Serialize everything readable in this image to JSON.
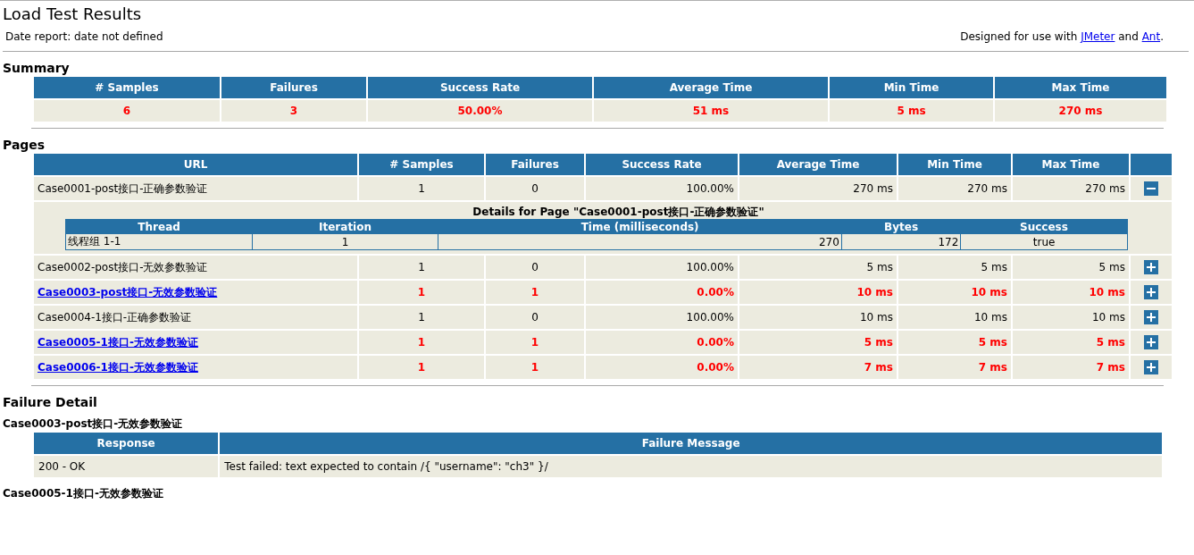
{
  "title": "Load Test Results",
  "date_report": "Date report: date not defined",
  "designed_for": {
    "prefix": "Designed for use with",
    "link1": "JMeter",
    "middle": "and",
    "link2": "Ant",
    "suffix": "."
  },
  "summary": {
    "heading": "Summary",
    "columns": [
      "# Samples",
      "Failures",
      "Success Rate",
      "Average Time",
      "Min Time",
      "Max Time"
    ],
    "values": [
      "6",
      "3",
      "50.00%",
      "51 ms",
      "5 ms",
      "270 ms"
    ],
    "failed": true
  },
  "pages": {
    "heading": "Pages",
    "columns": [
      "URL",
      "# Samples",
      "Failures",
      "Success Rate",
      "Average Time",
      "Min Time",
      "Max Time"
    ],
    "rows": [
      {
        "url": "Case0001-post接口-正确参数验证",
        "samples": "1",
        "failures": "0",
        "rate": "100.00%",
        "avg": "270 ms",
        "min": "270 ms",
        "max": "270 ms",
        "failed": false,
        "expanded": true,
        "details": {
          "title": "Details for Page \"Case0001-post接口-正确参数验证\"",
          "columns": [
            "Thread",
            "Iteration",
            "Time (milliseconds)",
            "Bytes",
            "Success"
          ],
          "rows": [
            [
              "线程组 1-1",
              "1",
              "270",
              "172",
              "true"
            ]
          ]
        }
      },
      {
        "url": "Case0002-post接口-无效参数验证",
        "samples": "1",
        "failures": "0",
        "rate": "100.00%",
        "avg": "5 ms",
        "min": "5 ms",
        "max": "5 ms",
        "failed": false,
        "expanded": false
      },
      {
        "url": "Case0003-post接口-无效参数验证",
        "samples": "1",
        "failures": "1",
        "rate": "0.00%",
        "avg": "10 ms",
        "min": "10 ms",
        "max": "10 ms",
        "failed": true,
        "expanded": false
      },
      {
        "url": "Case0004-1接口-正确参数验证",
        "samples": "1",
        "failures": "0",
        "rate": "100.00%",
        "avg": "10 ms",
        "min": "10 ms",
        "max": "10 ms",
        "failed": false,
        "expanded": false
      },
      {
        "url": "Case0005-1接口-无效参数验证",
        "samples": "1",
        "failures": "1",
        "rate": "0.00%",
        "avg": "5 ms",
        "min": "5 ms",
        "max": "5 ms",
        "failed": true,
        "expanded": false
      },
      {
        "url": "Case0006-1接口-无效参数验证",
        "samples": "1",
        "failures": "1",
        "rate": "0.00%",
        "avg": "7 ms",
        "min": "7 ms",
        "max": "7 ms",
        "failed": true,
        "expanded": false
      }
    ]
  },
  "failure_detail": {
    "heading": "Failure Detail",
    "cases": [
      {
        "title": "Case0003-post接口-无效参数验证",
        "columns": [
          "Response",
          "Failure Message"
        ],
        "rows": [
          [
            "200 - OK",
            "Test failed: text expected to contain /{ \"username\": \"ch3\" }/"
          ]
        ]
      },
      {
        "title": "Case0005-1接口-无效参数验证"
      }
    ]
  }
}
